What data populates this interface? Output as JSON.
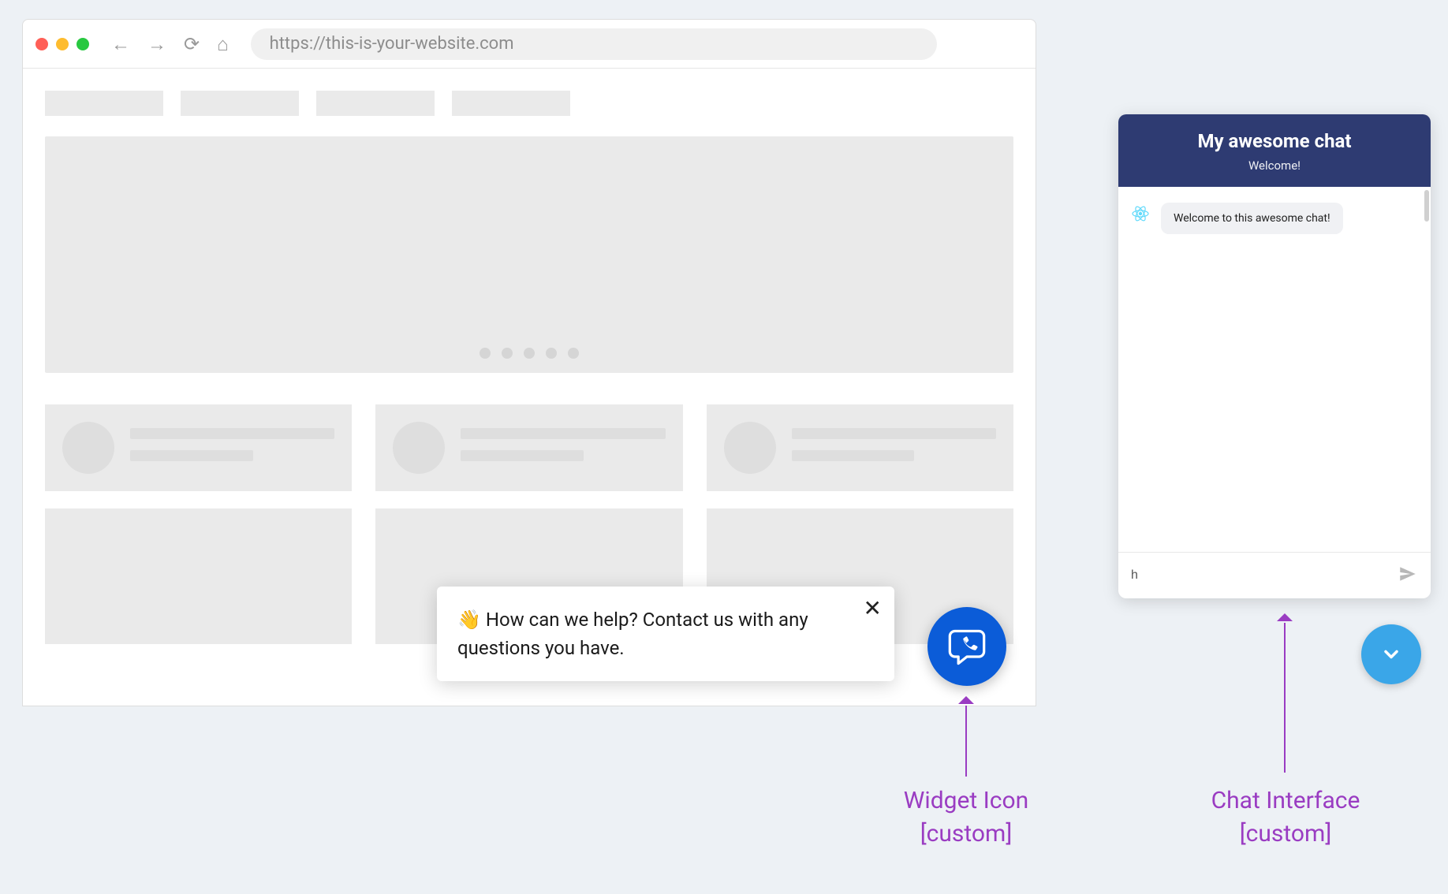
{
  "browser": {
    "url": "https://this-is-your-website.com"
  },
  "popup": {
    "text_prefix": "👋 ",
    "text": "How can we help? Contact us with any questions you have."
  },
  "chat": {
    "title": "My awesome chat",
    "subtitle": "Welcome!",
    "bot_message": "Welcome to this awesome chat!",
    "input_value": "h"
  },
  "labels": {
    "widget_line1": "Widget Icon",
    "widget_line2": "[custom]",
    "chat_line1": "Chat Interface",
    "chat_line2": "[custom]"
  }
}
